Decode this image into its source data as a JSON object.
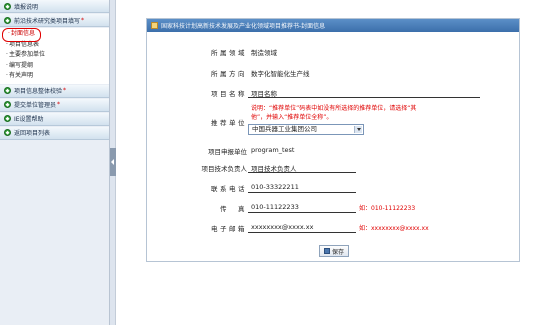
{
  "sidebar": {
    "sections": [
      {
        "label": "填报说明",
        "star": ""
      },
      {
        "label": "前沿技术研究类项目填写",
        "star": "*"
      }
    ],
    "sub_items": [
      "封面信息",
      "项目信息表",
      "主要参加单位",
      "编写提纲",
      "有关声明"
    ],
    "sections_after": [
      {
        "label": "项目信息整体校验",
        "star": "*"
      },
      {
        "label": "提交单位管理员",
        "star": "*"
      },
      {
        "label": "IE设置帮助",
        "star": ""
      },
      {
        "label": "返回项目列表",
        "star": ""
      }
    ]
  },
  "panel": {
    "title": "国家科技计划高新技术发展及产业化领域项目推荐书-封面信息",
    "fields": {
      "domain_label": "所属领域",
      "domain_value": "制造领域",
      "direction_label": "所属方向",
      "direction_value": "数字化智能化生产线",
      "project_name_label": "项目名称",
      "project_name_value": "项目名称",
      "recommend_unit_label": "推荐单位",
      "recommend_note": "说明：“推荐单位”码表中如没有所选择的推荐单位，请选择“其他”，并输入“推荐单位全称”。",
      "recommend_unit_value": "中国兵器工业集团公司",
      "applicant_unit_label": "项目申报单位",
      "applicant_unit_value": "program_test",
      "tech_lead_label": "项目技术负责人",
      "tech_lead_value": "项目技术负责人",
      "phone_label": "联系电话",
      "phone_value": "010-33322211",
      "fax_label": "传　真",
      "fax_value": "010-11122233",
      "fax_hint": "如：010-11122233",
      "email_label": "电子邮箱",
      "email_value": "xxxxxxxx@xxxx.xx",
      "email_hint": "如：xxxxxxxx@xxxx.xx"
    },
    "save_label": "保存"
  }
}
